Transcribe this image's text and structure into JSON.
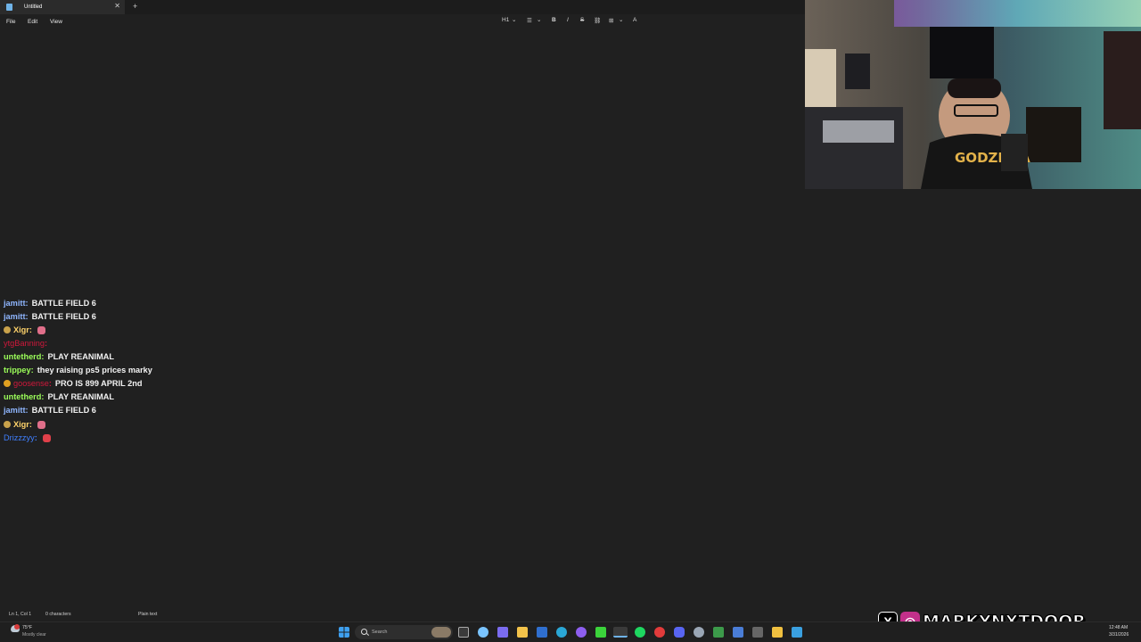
{
  "window": {
    "tab_title": "Untitled",
    "close_glyph": "✕",
    "add_glyph": "+"
  },
  "menu": [
    "File",
    "Edit",
    "View"
  ],
  "toolbar": {
    "heading_label": "H1",
    "heading_caret": "⌄",
    "list_glyph": "☰",
    "bold_glyph": "B",
    "italic_glyph": "I",
    "strike_glyph": "S",
    "link_glyph": "⛓",
    "table_glyph": "⊞",
    "clear_glyph": "A"
  },
  "status": {
    "position": "Ln 1, Col 1",
    "characters": "0 characters",
    "format": "Plain text"
  },
  "chat": {
    "messages": [
      {
        "user": "jamitt",
        "text": "BATTLE FIELD 6",
        "color": "#8fb6ff"
      },
      {
        "user": "jamitt",
        "text": "BATTLE FIELD 6",
        "color": "#8fb6ff"
      },
      {
        "user": "Xigr",
        "text": "",
        "color": "#ffd36b",
        "badge": "#c9a24b",
        "emote": "#e06f8a"
      },
      {
        "user": "ytgBanning",
        "text": "",
        "color": "#d0183b"
      },
      {
        "user": "untetherd",
        "text": "PLAY REANIMAL",
        "color": "#9cff5a"
      },
      {
        "user": "trippey",
        "text": "they raising ps5 prices marky",
        "color": "#9cff5a"
      },
      {
        "user": "goosense",
        "text": "PRO IS 899 APRIL 2nd",
        "color": "#d0183b",
        "badge": "#e0a020"
      },
      {
        "user": "untetherd",
        "text": "PLAY REANIMAL",
        "color": "#9cff5a"
      },
      {
        "user": "jamitt",
        "text": "BATTLE FIELD 6",
        "color": "#8fb6ff"
      },
      {
        "user": "Xigr",
        "text": "",
        "color": "#ffd36b",
        "badge": "#c9a24b",
        "emote": "#e06f8a"
      },
      {
        "user": "Drizzzyy",
        "text": "",
        "color": "#3f7fff",
        "emote": "#e0404a"
      }
    ]
  },
  "overlay": {
    "handle": "MARKYNXTDOOR",
    "x_glyph": "X",
    "ig_glyph": "◎"
  },
  "taskbar": {
    "weather_temp": "75°F",
    "weather_condition": "Mostly clear",
    "search_placeholder": "Search",
    "time": "12:48 AM",
    "date": "3/31/2026",
    "icons": [
      "widgets-icon",
      "start-icon",
      "task-view-icon",
      "explorer-icon",
      "edge-icon",
      "steam-icon",
      "spotify-icon"
    ]
  },
  "colors": {
    "editor_bg": "#202020",
    "taskbar_bg": "#1f1f1f",
    "accent": "#6fb3e8"
  }
}
